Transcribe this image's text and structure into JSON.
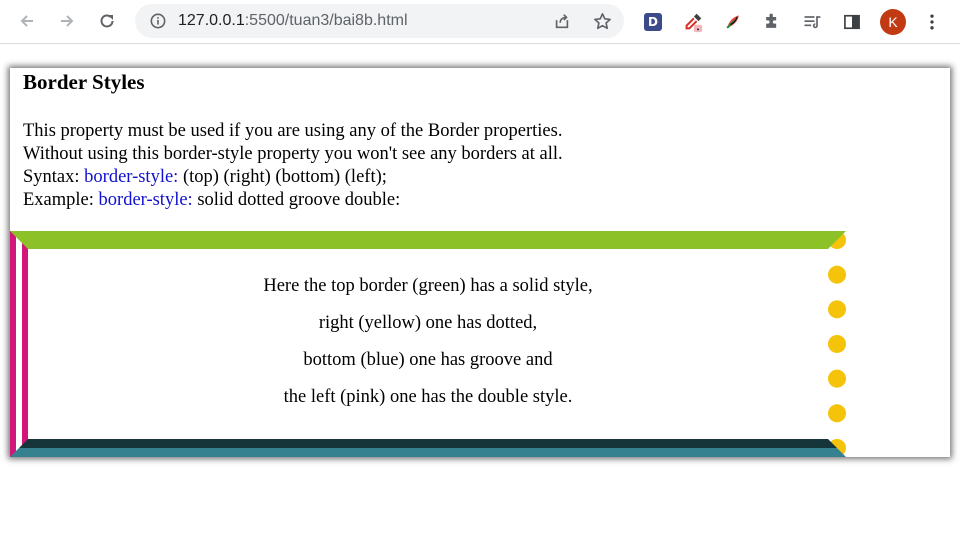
{
  "browser": {
    "url_host": "127.0.0.1",
    "url_path": ":5500/tuan3/bai8b.html",
    "extension_d_label": "D",
    "profile_initial": "K"
  },
  "icons": {
    "back": "arrow-left-icon",
    "forward": "arrow-right-icon",
    "reload": "reload-icon",
    "info": "info-icon",
    "share": "share-icon",
    "bookmark": "star-icon",
    "eyedropper": "eyedropper-icon",
    "feather": "feather-icon",
    "extensions": "puzzle-icon",
    "reading_list": "reading-list-icon",
    "side_panel": "side-panel-icon",
    "menu": "kebab-menu-icon"
  },
  "page": {
    "heading": "Border Styles",
    "intro": {
      "line1": "This property must be used if you are using any of the Border properties.",
      "line2": "Without using this border-style property you won't see any borders at all.",
      "syntax_label": "Syntax: ",
      "syntax_keyword": "border-style:",
      "syntax_value": " (top) (right) (bottom) (left);",
      "example_label": "Example: ",
      "example_keyword": "border-style:",
      "example_value": " solid dotted groove double:"
    },
    "demo_lines": [
      "Here the top border (green) has a solid style,",
      "right (yellow) one has dotted,",
      "bottom (blue) one has groove and",
      "the left (pink) one has the double style."
    ]
  },
  "colors": {
    "top_border": "#8cc228",
    "right_border": "#f5c30a",
    "bottom_border": "#36818f",
    "left_border": "#d2167a",
    "keyword": "#1010d0",
    "avatar": "#c23a14"
  }
}
